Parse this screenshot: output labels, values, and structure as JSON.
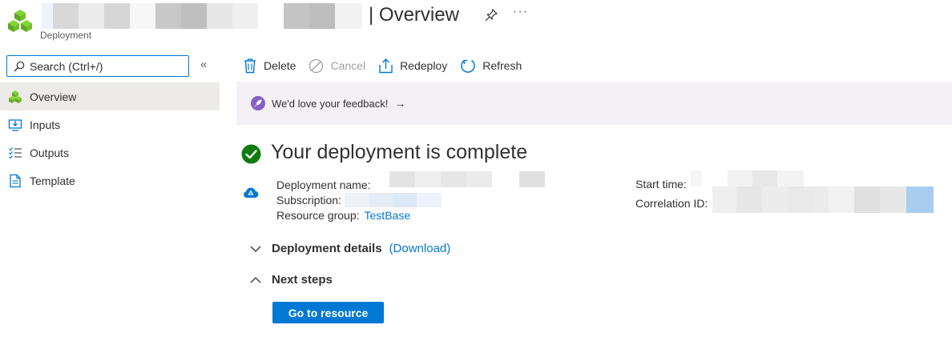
{
  "header": {
    "title": "| Overview",
    "subtitle": "Deployment",
    "more_label": "···"
  },
  "sidebar": {
    "search_placeholder": "Search (Ctrl+/)",
    "collapse_label": "«",
    "items": [
      {
        "label": "Overview",
        "icon": "deployment-icon",
        "active": true
      },
      {
        "label": "Inputs",
        "icon": "inputs-icon",
        "active": false
      },
      {
        "label": "Outputs",
        "icon": "outputs-icon",
        "active": false
      },
      {
        "label": "Template",
        "icon": "template-icon",
        "active": false
      }
    ]
  },
  "toolbar": {
    "delete_label": "Delete",
    "cancel_label": "Cancel",
    "redeploy_label": "Redeploy",
    "refresh_label": "Refresh"
  },
  "banner": {
    "text": "We'd love your feedback!",
    "arrow": "→"
  },
  "status": {
    "title": "Your deployment is complete"
  },
  "details": {
    "deployment_name_label": "Deployment name:",
    "subscription_label": "Subscription:",
    "resource_group_label": "Resource group:",
    "resource_group_value": "TestBase",
    "start_time_label": "Start time:",
    "correlation_id_label": "Correlation ID:"
  },
  "sections": {
    "deployment_details_label": "Deployment details",
    "download_label": "(Download)",
    "next_steps_label": "Next steps",
    "go_to_resource_label": "Go to resource"
  },
  "colors": {
    "accent": "#0078d4",
    "success": "#107c10",
    "banner_bg": "#f3f0f6",
    "rocket": "#8661c5",
    "active_nav": "#edebe9"
  }
}
